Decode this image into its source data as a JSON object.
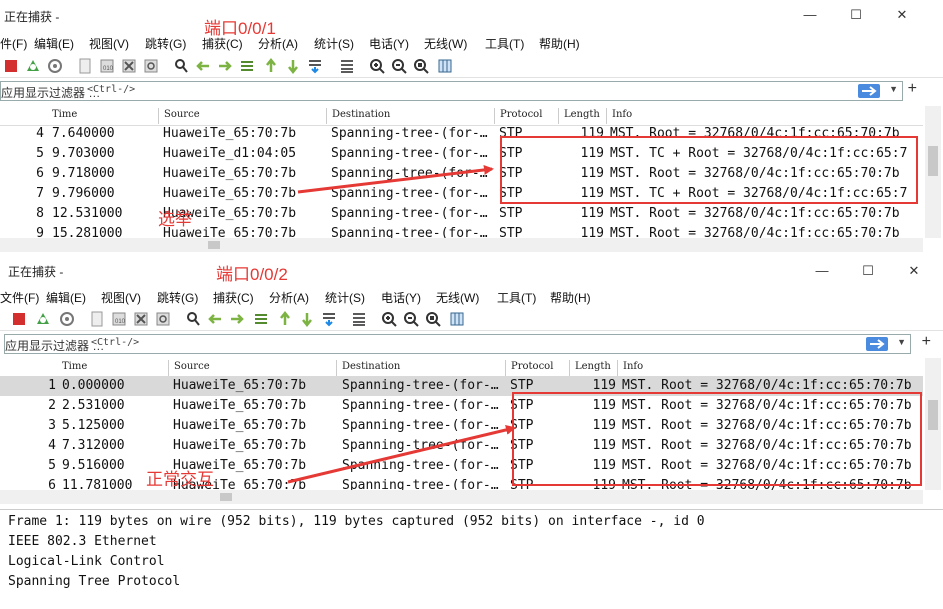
{
  "colors": {
    "annotation": "#e53935",
    "selected_row": "#d9d9d9",
    "filter_arrow": "#4a8be0"
  },
  "window1": {
    "title": "正在捕获 -",
    "annotation": "端口0/0/1",
    "menu": [
      "件(F)",
      "编辑(E)",
      "视图(V)",
      "跳转(G)",
      "捕获(C)",
      "分析(A)",
      "统计(S)",
      "电话(Y)",
      "无线(W)",
      "工具(T)",
      "帮助(H)"
    ],
    "filter": {
      "label": "应用显示过滤器 …",
      "placeholder": "<Ctrl-/>"
    },
    "columns": [
      "Time",
      "Source",
      "Destination",
      "Protocol",
      "Length",
      "Info"
    ],
    "rows": [
      {
        "no": "4",
        "time": "7.640000",
        "source": "HuaweiTe_65:70:7b",
        "destination": "Spanning-tree-(for-…",
        "protocol": "STP",
        "length": "119",
        "info": "MST. Root = 32768/0/4c:1f:cc:65:70:7b"
      },
      {
        "no": "5",
        "time": "9.703000",
        "source": "HuaweiTe_d1:04:05",
        "destination": "Spanning-tree-(for-…",
        "protocol": "STP",
        "length": "119",
        "info": "MST. TC + Root = 32768/0/4c:1f:cc:65:7"
      },
      {
        "no": "6",
        "time": "9.718000",
        "source": "HuaweiTe_65:70:7b",
        "destination": "Spanning-tree-(for-…",
        "protocol": "STP",
        "length": "119",
        "info": "MST. Root = 32768/0/4c:1f:cc:65:70:7b"
      },
      {
        "no": "7",
        "time": "9.796000",
        "source": "HuaweiTe_65:70:7b",
        "destination": "Spanning-tree-(for-…",
        "protocol": "STP",
        "length": "119",
        "info": "MST. TC + Root = 32768/0/4c:1f:cc:65:7"
      },
      {
        "no": "8",
        "time": "12.531000",
        "source": "HuaweiTe_65:70:7b",
        "destination": "Spanning-tree-(for-…",
        "protocol": "STP",
        "length": "119",
        "info": "MST. Root = 32768/0/4c:1f:cc:65:70:7b"
      },
      {
        "no": "9",
        "time": "15.281000",
        "source": "HuaweiTe_65:70:7b",
        "destination": "Spanning-tree-(for-…",
        "protocol": "STP",
        "length": "119",
        "info": "MST. Root = 32768/0/4c:1f:cc:65:70:7b"
      }
    ],
    "label_annotation": "选举"
  },
  "window2": {
    "title": "正在捕获 -",
    "annotation": "端口0/0/2",
    "menu": [
      "文件(F)",
      "编辑(E)",
      "视图(V)",
      "跳转(G)",
      "捕获(C)",
      "分析(A)",
      "统计(S)",
      "电话(Y)",
      "无线(W)",
      "工具(T)",
      "帮助(H)"
    ],
    "filter": {
      "label": "应用显示过滤器 …",
      "placeholder": "<Ctrl-/>"
    },
    "columns": [
      "Time",
      "Source",
      "Destination",
      "Protocol",
      "Length",
      "Info"
    ],
    "rows": [
      {
        "no": "1",
        "time": "0.000000",
        "source": "HuaweiTe_65:70:7b",
        "destination": "Spanning-tree-(for-…",
        "protocol": "STP",
        "length": "119",
        "info": "MST. Root = 32768/0/4c:1f:cc:65:70:7b"
      },
      {
        "no": "2",
        "time": "2.531000",
        "source": "HuaweiTe_65:70:7b",
        "destination": "Spanning-tree-(for-…",
        "protocol": "STP",
        "length": "119",
        "info": "MST. Root = 32768/0/4c:1f:cc:65:70:7b"
      },
      {
        "no": "3",
        "time": "5.125000",
        "source": "HuaweiTe_65:70:7b",
        "destination": "Spanning-tree-(for-…",
        "protocol": "STP",
        "length": "119",
        "info": "MST. Root = 32768/0/4c:1f:cc:65:70:7b"
      },
      {
        "no": "4",
        "time": "7.312000",
        "source": "HuaweiTe_65:70:7b",
        "destination": "Spanning-tree-(for-…",
        "protocol": "STP",
        "length": "119",
        "info": "MST. Root = 32768/0/4c:1f:cc:65:70:7b"
      },
      {
        "no": "5",
        "time": "9.516000",
        "source": "HuaweiTe_65:70:7b",
        "destination": "Spanning-tree-(for-…",
        "protocol": "STP",
        "length": "119",
        "info": "MST. Root = 32768/0/4c:1f:cc:65:70:7b"
      },
      {
        "no": "6",
        "time": "11.781000",
        "source": "HuaweiTe_65:70:7b",
        "destination": "Spanning-tree-(for-…",
        "protocol": "STP",
        "length": "119",
        "info": "MST. Root = 32768/0/4c:1f:cc:65:70:7b"
      }
    ],
    "label_annotation": "正常交互"
  },
  "details": [
    "Frame 1: 119 bytes on wire (952 bits), 119 bytes captured (952 bits) on interface -, id 0",
    "IEEE 802.3 Ethernet",
    "Logical-Link Control",
    "Spanning Tree Protocol"
  ],
  "icons": {
    "toolbar": [
      "stop-capture-icon",
      "restart-capture-icon",
      "capture-options-icon",
      "open-file-icon",
      "save-file-icon",
      "close-file-icon",
      "reload-file-icon",
      "find-packet-icon",
      "go-back-icon",
      "go-forward-icon",
      "go-to-packet-icon",
      "go-first-icon",
      "go-last-icon",
      "autoscroll-icon",
      "colorize-icon",
      "zoom-in-icon",
      "zoom-out-icon",
      "zoom-reset-icon",
      "resize-columns-icon"
    ],
    "window": [
      "minimize-icon",
      "maximize-icon",
      "close-icon"
    ]
  }
}
